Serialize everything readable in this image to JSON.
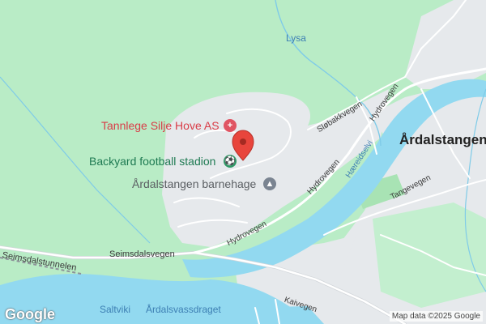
{
  "map": {
    "pois": {
      "dentist": "Tannlege Silje Hove AS",
      "stadium": "Backyard football stadion",
      "kindergarten": "Årdalstangen barnehage"
    },
    "places": {
      "town": "Årdalstangen",
      "saltviki": "Saltviki",
      "fjord": "Årdalsvassdraget"
    },
    "water": {
      "stream": "Lysa",
      "river": "Hæreidselvi"
    },
    "roads": {
      "slobakkvegen": "Sløbakkvegen",
      "hydrovegen_1": "Hydrovegen",
      "hydrovegen_2": "Hydrovegen",
      "hydrovegen_3": "Hydrovegen",
      "tangevegen": "Tangevegen",
      "seimsdalsvegen": "Seimsdalsvegen",
      "seimsdalstunnelen": "Seimsdalstunnelen",
      "kaivegen": "Kaivegen"
    },
    "logo": "Google",
    "credit": "Map data ©2025 Google",
    "colors": {
      "land": "#b9ecc6",
      "water": "#92d9f0",
      "urban": "#eaecee",
      "pin": "#e8453c",
      "poi_dentist": "#d93c47",
      "poi_green": "#1e7a52"
    }
  }
}
